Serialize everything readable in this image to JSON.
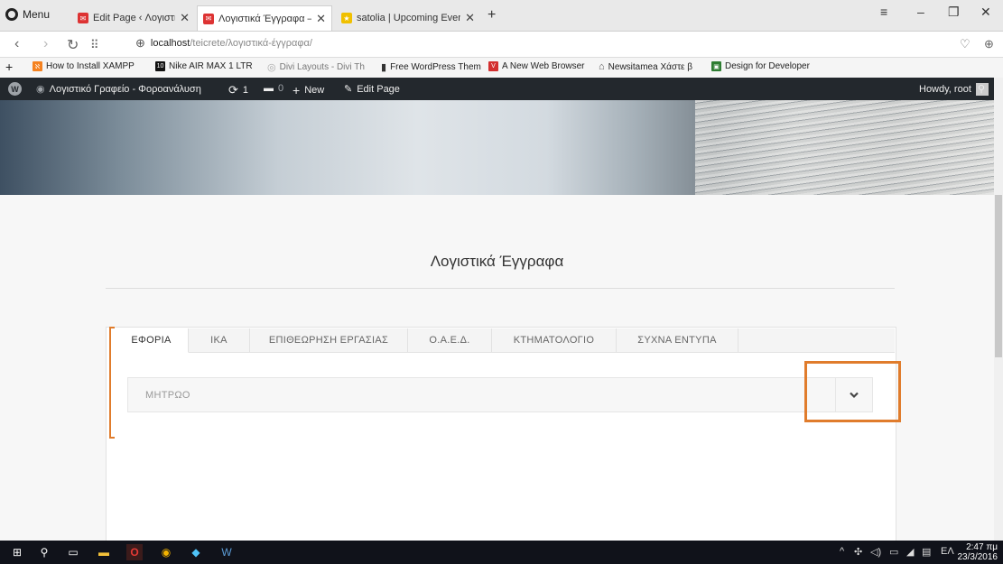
{
  "browser": {
    "menu_label": "Menu",
    "tabs": [
      {
        "title": "Edit Page ‹ Λογιστικό Γρα"
      },
      {
        "title": "Λογιστικά Έγγραφα – Λογ"
      },
      {
        "title": "satolia | Upcoming Events"
      }
    ],
    "url_host": "localhost",
    "url_path": "/teicrete/λογιστικά-έγγραφα/",
    "bookmarks": [
      {
        "label": "How to Install XAMPP",
        "color": "#f58220",
        "icon": "xampp-icon"
      },
      {
        "label": "Nike AIR MAX 1 LTR",
        "color": "#111111",
        "icon": "nike-icon"
      },
      {
        "label": "Divi Layouts - Divi Th",
        "color": "#cccccc",
        "icon": "divi-icon"
      },
      {
        "label": "Free WordPress Them",
        "color": "#333333",
        "icon": "document-icon"
      },
      {
        "label": "A New Web Browser",
        "color": "#d32f2f",
        "icon": "vivaldi-icon"
      },
      {
        "label": "Newsitamea Χάστε β",
        "color": "#666666",
        "icon": "newsitamea-icon"
      },
      {
        "label": "Design for Developer",
        "color": "#2e7d32",
        "icon": "design-icon"
      }
    ]
  },
  "wp_admin_bar": {
    "site_name": "Λογιστικό Γραφείο - Φοροανάλυση",
    "updates_count": "1",
    "comments_count": "0",
    "new_label": "New",
    "edit_label": "Edit Page",
    "howdy": "Howdy, root"
  },
  "page": {
    "title": "Λογιστικά Έγγραφα",
    "tabs": [
      {
        "label": "ΕΦΟΡΙΑ",
        "active": true
      },
      {
        "label": "ΙΚΑ",
        "active": false
      },
      {
        "label": "ΕΠΙΘΕΩΡΗΣΗ ΕΡΓΑΣΙΑΣ",
        "active": false
      },
      {
        "label": "Ο.Α.Ε.Δ.",
        "active": false
      },
      {
        "label": "ΚΤΗΜΑΤΟΛΟΓΙΟ",
        "active": false
      },
      {
        "label": "ΣΥΧΝΑ ΕΝΤΥΠΑ",
        "active": false
      }
    ],
    "accordion_label": "ΜΗΤΡΩΟ",
    "highlight_color": "#e07c2c"
  },
  "taskbar": {
    "language": "ΕΛ",
    "time": "2:47 πμ",
    "date": "23/3/2016"
  }
}
